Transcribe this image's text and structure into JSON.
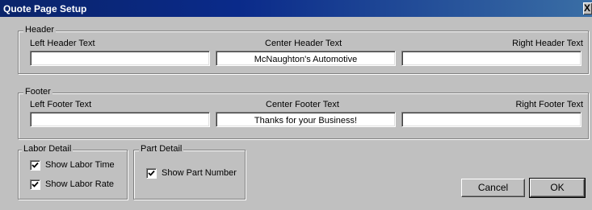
{
  "window": {
    "title": "Quote Page Setup",
    "close_glyph": "X"
  },
  "header": {
    "legend": "Header",
    "left_label": "Left Header Text",
    "center_label": "Center Header Text",
    "right_label": "Right Header Text",
    "left_value": "",
    "center_value": "McNaughton's Automotive",
    "right_value": ""
  },
  "footer": {
    "legend": "Footer",
    "left_label": "Left Footer Text",
    "center_label": "Center Footer Text",
    "right_label": "Right Footer Text",
    "left_value": "",
    "center_value": "Thanks for your Business!",
    "right_value": ""
  },
  "labor_detail": {
    "legend": "Labor Detail",
    "show_time_label": "Show Labor Time",
    "show_time_checked": true,
    "show_rate_label": "Show Labor Rate",
    "show_rate_checked": true
  },
  "part_detail": {
    "legend": "Part Detail",
    "show_number_label": "Show Part Number",
    "show_number_checked": true
  },
  "buttons": {
    "cancel": "Cancel",
    "ok": "OK"
  }
}
